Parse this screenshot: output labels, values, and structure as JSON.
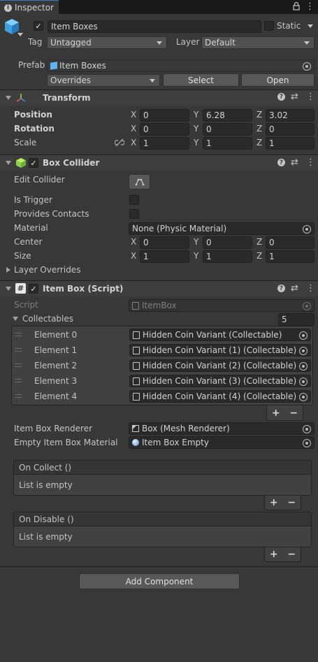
{
  "tab": {
    "title": "Inspector"
  },
  "gameobject": {
    "name": "Item Boxes",
    "static_label": "Static",
    "tag_label": "Tag",
    "tag_value": "Untagged",
    "layer_label": "Layer",
    "layer_value": "Default",
    "prefab_label": "Prefab",
    "prefab_value": "Item Boxes",
    "overrides_label": "Overrides",
    "select_label": "Select",
    "open_label": "Open"
  },
  "transform": {
    "title": "Transform",
    "position_label": "Position",
    "rotation_label": "Rotation",
    "scale_label": "Scale",
    "position": {
      "x": "0",
      "y": "6.28",
      "z": "3.02"
    },
    "rotation": {
      "x": "0",
      "y": "0",
      "z": "0"
    },
    "scale": {
      "x": "1",
      "y": "1",
      "z": "1"
    },
    "axis": {
      "x": "X",
      "y": "Y",
      "z": "Z"
    }
  },
  "box_collider": {
    "title": "Box Collider",
    "edit_collider_label": "Edit Collider",
    "is_trigger_label": "Is Trigger",
    "provides_contacts_label": "Provides Contacts",
    "material_label": "Material",
    "material_value": "None (Physic Material)",
    "center_label": "Center",
    "size_label": "Size",
    "center": {
      "x": "0",
      "y": "0",
      "z": "0"
    },
    "size": {
      "x": "1",
      "y": "1",
      "z": "1"
    },
    "layer_overrides_label": "Layer Overrides"
  },
  "item_box": {
    "title": "Item Box (Script)",
    "script_label": "Script",
    "script_value": "ItemBox",
    "collectables_label": "Collectables",
    "collectables_count": "5",
    "elements": [
      {
        "label": "Element 0",
        "value": "Hidden Coin Variant (Collectable)"
      },
      {
        "label": "Element 1",
        "value": "Hidden Coin Variant (1) (Collectable)"
      },
      {
        "label": "Element 2",
        "value": "Hidden Coin Variant (2) (Collectable)"
      },
      {
        "label": "Element 3",
        "value": "Hidden Coin Variant (3) (Collectable)"
      },
      {
        "label": "Element 4",
        "value": "Hidden Coin Variant (4) (Collectable)"
      }
    ],
    "renderer_label": "Item Box Renderer",
    "renderer_value": "Box (Mesh Renderer)",
    "empty_material_label": "Empty Item Box Material",
    "empty_material_value": "Item Box Empty",
    "on_collect_label": "On Collect ()",
    "on_collect_empty": "List is empty",
    "on_disable_label": "On Disable ()",
    "on_disable_empty": "List is empty",
    "plus": "+",
    "minus": "−"
  },
  "add_component_label": "Add Component",
  "icons": {
    "help": "?",
    "settings": "⇄",
    "menu": "⋮",
    "lock": "lock-icon",
    "check": "✓"
  },
  "colors": {
    "accent": "#3a79bb",
    "background": "#383838",
    "field": "#2a2a2a",
    "header": "#3e3e3e"
  }
}
